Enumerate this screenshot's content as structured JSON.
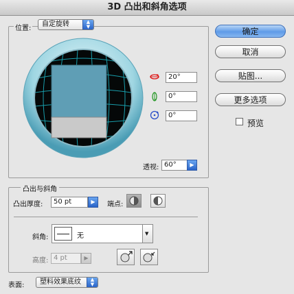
{
  "window": {
    "title": "3D 凸出和斜角选项"
  },
  "position": {
    "label": "位置:",
    "value": "自定旋转"
  },
  "rotation": {
    "x": "20°",
    "y": "0°",
    "z": "0°"
  },
  "perspective": {
    "label": "透视:",
    "value": "60°"
  },
  "buttons": {
    "ok": "确定",
    "cancel": "取消",
    "map": "贴图...",
    "more": "更多选项"
  },
  "preview": {
    "label": "预览",
    "checked": false
  },
  "extrude": {
    "section_label": "凸出与斜角",
    "depth_label": "凸出厚度:",
    "depth_value": "50 pt",
    "cap_label": "端点:",
    "bevel_label": "斜角:",
    "bevel_value": "无",
    "height_label": "高度:",
    "height_value": "4 pt"
  },
  "surface": {
    "label": "表面:",
    "value": "塑料效果底纹"
  },
  "colors": {
    "accent": "#2a64c8",
    "cube_face": "#5f9eb5",
    "grid_line": "#1db8c8"
  },
  "icons": {
    "x_axis": "rotate-x-icon",
    "y_axis": "rotate-y-icon",
    "z_axis": "rotate-z-icon",
    "cap_on": "cap-on-icon",
    "cap_off": "cap-off-icon",
    "bevel_out": "bevel-out-icon",
    "bevel_in": "bevel-in-icon"
  }
}
